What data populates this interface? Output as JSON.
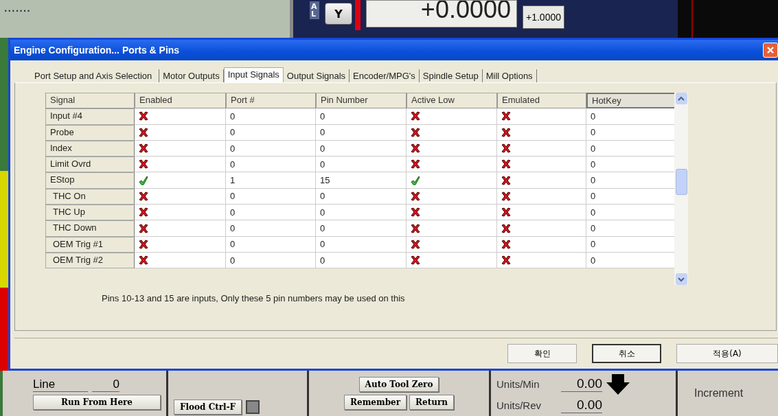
{
  "background_app": {
    "top": {
      "dots": ".......",
      "axis_letters": "A L",
      "axis_button": "Y",
      "readout": "+0.0000",
      "scale_button": "+1.0000"
    },
    "bottom": {
      "line_label": "Line",
      "line_value": "0",
      "run_from_here": "Run From Here",
      "flood": "Flood Ctrl-F",
      "auto_tool_zero": "Auto Tool Zero",
      "remember": "Remember",
      "return": "Return",
      "units_min_label": "Units/Min",
      "units_min_value": "0.00",
      "units_rev_label": "Units/Rev",
      "units_rev_value": "0.00",
      "increment_label": "Increment"
    }
  },
  "window": {
    "title": "Engine Configuration... Ports & Pins"
  },
  "tabs": [
    {
      "label": "Port Setup and Axis Selection",
      "selected": false
    },
    {
      "label": "Motor Outputs",
      "selected": false
    },
    {
      "label": "Input Signals",
      "selected": true
    },
    {
      "label": "Output Signals",
      "selected": false
    },
    {
      "label": "Encoder/MPG's",
      "selected": false
    },
    {
      "label": "Spindle Setup",
      "selected": false
    },
    {
      "label": "Mill Options",
      "selected": false
    }
  ],
  "table": {
    "columns": [
      "Signal",
      "Enabled",
      "Port #",
      "Pin Number",
      "Active Low",
      "Emulated",
      "HotKey"
    ],
    "rows": [
      {
        "signal": "Input #4",
        "enabled": false,
        "port": "0",
        "pin": "0",
        "active_low": false,
        "emulated": false,
        "hotkey": "0"
      },
      {
        "signal": "Probe",
        "enabled": false,
        "port": "0",
        "pin": "0",
        "active_low": false,
        "emulated": false,
        "hotkey": "0"
      },
      {
        "signal": "Index",
        "enabled": false,
        "port": "0",
        "pin": "0",
        "active_low": false,
        "emulated": false,
        "hotkey": "0"
      },
      {
        "signal": "Limit Ovrd",
        "enabled": false,
        "port": "0",
        "pin": "0",
        "active_low": false,
        "emulated": false,
        "hotkey": "0"
      },
      {
        "signal": "EStop",
        "enabled": true,
        "port": "1",
        "pin": "15",
        "active_low": true,
        "emulated": false,
        "hotkey": "0"
      },
      {
        "signal": "THC On",
        "enabled": false,
        "port": "0",
        "pin": "0",
        "active_low": false,
        "emulated": false,
        "hotkey": "0"
      },
      {
        "signal": "THC Up",
        "enabled": false,
        "port": "0",
        "pin": "0",
        "active_low": false,
        "emulated": false,
        "hotkey": "0"
      },
      {
        "signal": "THC Down",
        "enabled": false,
        "port": "0",
        "pin": "0",
        "active_low": false,
        "emulated": false,
        "hotkey": "0"
      },
      {
        "signal": "OEM Trig #1",
        "enabled": false,
        "port": "0",
        "pin": "0",
        "active_low": false,
        "emulated": false,
        "hotkey": "0"
      },
      {
        "signal": "OEM Trig #2",
        "enabled": false,
        "port": "0",
        "pin": "0",
        "active_low": false,
        "emulated": false,
        "hotkey": "0"
      }
    ]
  },
  "note": "Pins 10-13 and 15 are inputs, Only these 5 pin numbers may be used on this",
  "buttons": [
    "확인",
    "취소",
    "적용(A)"
  ]
}
